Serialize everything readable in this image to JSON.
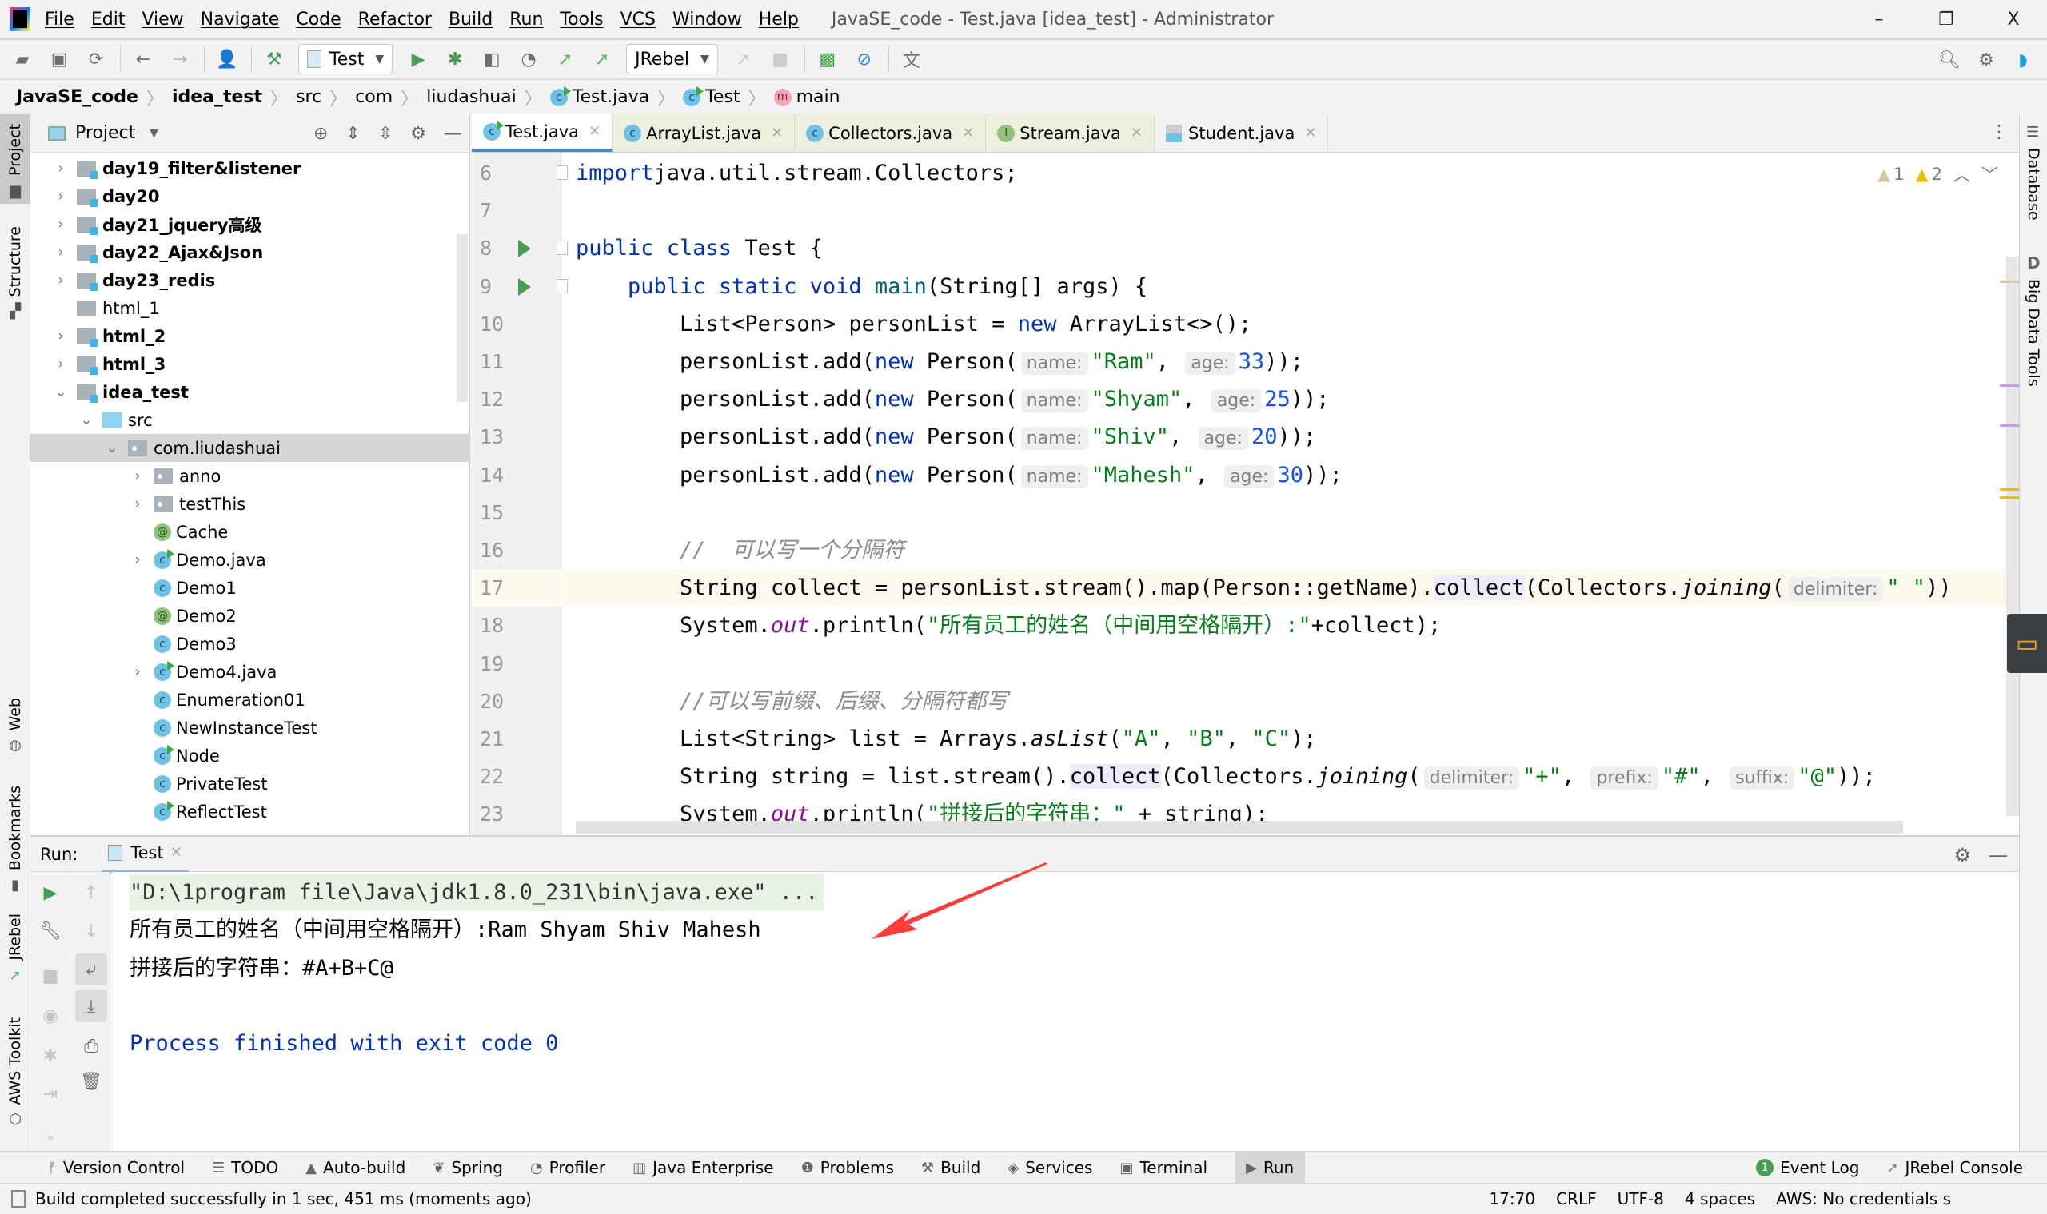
{
  "titlebar": {
    "menu": [
      "File",
      "Edit",
      "View",
      "Navigate",
      "Code",
      "Refactor",
      "Build",
      "Run",
      "Tools",
      "VCS",
      "Window",
      "Help"
    ],
    "window_title": "JavaSE_code - Test.java [idea_test] - Administrator",
    "controls": {
      "minimize": "–",
      "restore": "❐",
      "close": "X"
    }
  },
  "toolbar": {
    "run_config": "Test",
    "jrebel_config": "JRebel",
    "icons": [
      "open-icon",
      "save-icon",
      "sync-icon",
      "back-icon",
      "forward-icon",
      "user-icon",
      "build-hammer-icon",
      "run-icon",
      "debug-icon",
      "coverage-icon",
      "profile-icon",
      "jrebel-run-icon",
      "jrebel-debug-icon",
      "attach-icon",
      "stop-icon",
      "monitor-icon",
      "no-icon",
      "translate-icon",
      "search-icon",
      "settings-icon",
      "toolbox-icon"
    ]
  },
  "breadcrumb": [
    {
      "label": "JavaSE_code",
      "bold": true
    },
    {
      "label": "idea_test",
      "bold": true
    },
    {
      "label": "src"
    },
    {
      "label": "com"
    },
    {
      "label": "liudashuai"
    },
    {
      "label": "Test.java",
      "icon": "class"
    },
    {
      "label": "Test",
      "icon": "class"
    },
    {
      "label": "main",
      "icon": "method"
    }
  ],
  "left_strip": {
    "tabs": [
      "Project",
      "Structure",
      "Web",
      "Bookmarks",
      "JRebel",
      "AWS Toolkit"
    ]
  },
  "right_strip": {
    "tabs": [
      "Database",
      "Big Data Tools"
    ]
  },
  "project_panel": {
    "title": "Project",
    "tree": [
      {
        "label": "day19_filter&listener",
        "type": "module",
        "depth": 0,
        "expand": "collapsed"
      },
      {
        "label": "day20",
        "type": "module",
        "depth": 0,
        "expand": "collapsed"
      },
      {
        "label": "day21_jquery高级",
        "type": "module",
        "depth": 0,
        "expand": "collapsed"
      },
      {
        "label": "day22_Ajax&Json",
        "type": "module",
        "depth": 0,
        "expand": "collapsed"
      },
      {
        "label": "day23_redis",
        "type": "module",
        "depth": 0,
        "expand": "collapsed"
      },
      {
        "label": "html_1",
        "type": "folder",
        "depth": 0,
        "expand": "none"
      },
      {
        "label": "html_2",
        "type": "module",
        "depth": 0,
        "expand": "collapsed"
      },
      {
        "label": "html_3",
        "type": "module",
        "depth": 0,
        "expand": "collapsed"
      },
      {
        "label": "idea_test",
        "type": "module",
        "depth": 0,
        "expand": "expanded"
      },
      {
        "label": "src",
        "type": "src",
        "depth": 1,
        "expand": "expanded"
      },
      {
        "label": "com.liudashuai",
        "type": "package",
        "depth": 2,
        "expand": "expanded",
        "selected": true
      },
      {
        "label": "anno",
        "type": "package",
        "depth": 3,
        "expand": "collapsed"
      },
      {
        "label": "testThis",
        "type": "package",
        "depth": 3,
        "expand": "collapsed"
      },
      {
        "label": "Cache",
        "type": "annotation",
        "depth": 3,
        "expand": "none"
      },
      {
        "label": "Demo.java",
        "type": "class-run",
        "depth": 3,
        "expand": "collapsed"
      },
      {
        "label": "Demo1",
        "type": "class",
        "depth": 3,
        "expand": "none"
      },
      {
        "label": "Demo2",
        "type": "annotation",
        "depth": 3,
        "expand": "none"
      },
      {
        "label": "Demo3",
        "type": "class",
        "depth": 3,
        "expand": "none"
      },
      {
        "label": "Demo4.java",
        "type": "class-run",
        "depth": 3,
        "expand": "collapsed"
      },
      {
        "label": "Enumeration01",
        "type": "class",
        "depth": 3,
        "expand": "none"
      },
      {
        "label": "NewInstanceTest",
        "type": "class",
        "depth": 3,
        "expand": "none"
      },
      {
        "label": "Node",
        "type": "class-run",
        "depth": 3,
        "expand": "none"
      },
      {
        "label": "PrivateTest",
        "type": "class",
        "depth": 3,
        "expand": "none"
      },
      {
        "label": "ReflectTest",
        "type": "class-run",
        "depth": 3,
        "expand": "none"
      }
    ]
  },
  "editor": {
    "tabs": [
      {
        "label": "Test.java",
        "icon": "class-run",
        "active": true
      },
      {
        "label": "ArrayList.java",
        "icon": "class-lib"
      },
      {
        "label": "Collectors.java",
        "icon": "class-lib"
      },
      {
        "label": "Stream.java",
        "icon": "interface-lib"
      },
      {
        "label": "Student.java",
        "icon": "java-file"
      }
    ],
    "inspections": {
      "weak_warnings": "1",
      "warnings": "2"
    },
    "current_line": 17,
    "lines": [
      {
        "n": 6,
        "tokens": [
          [
            "kw",
            "import"
          ],
          [
            "",
            "java.util.stream.Collectors;"
          ]
        ]
      },
      {
        "n": 7,
        "tokens": []
      },
      {
        "n": 8,
        "run": true,
        "tokens": [
          [
            "kw",
            "public class "
          ],
          [
            "",
            "Test {"
          ]
        ]
      },
      {
        "n": 9,
        "run": true,
        "tokens": [
          [
            "",
            "    "
          ],
          [
            "kw",
            "public static void "
          ],
          [
            "mth",
            "main"
          ],
          [
            "",
            "(String[] args) {"
          ]
        ]
      },
      {
        "n": 10,
        "tokens": [
          [
            "",
            "        List<Person> personList = "
          ],
          [
            "kw",
            "new "
          ],
          [
            "",
            "ArrayList<>();"
          ]
        ]
      },
      {
        "n": 11,
        "tokens": [
          [
            "",
            "        personList.add("
          ],
          [
            "kw",
            "new "
          ],
          [
            "",
            "Person("
          ],
          [
            "hint",
            "name:"
          ],
          [
            "str",
            "\"Ram\""
          ],
          [
            "",
            ", "
          ],
          [
            "hint",
            "age:"
          ],
          [
            "num",
            "33"
          ],
          [
            "",
            "));"
          ]
        ]
      },
      {
        "n": 12,
        "tokens": [
          [
            "",
            "        personList.add("
          ],
          [
            "kw",
            "new "
          ],
          [
            "",
            "Person("
          ],
          [
            "hint",
            "name:"
          ],
          [
            "str",
            "\"Shyam\""
          ],
          [
            "",
            ", "
          ],
          [
            "hint",
            "age:"
          ],
          [
            "num",
            "25"
          ],
          [
            "",
            "));"
          ]
        ]
      },
      {
        "n": 13,
        "tokens": [
          [
            "",
            "        personList.add("
          ],
          [
            "kw",
            "new "
          ],
          [
            "",
            "Person("
          ],
          [
            "hint",
            "name:"
          ],
          [
            "str",
            "\"Shiv\""
          ],
          [
            "",
            ", "
          ],
          [
            "hint",
            "age:"
          ],
          [
            "num",
            "20"
          ],
          [
            "",
            "));"
          ]
        ]
      },
      {
        "n": 14,
        "tokens": [
          [
            "",
            "        personList.add("
          ],
          [
            "kw",
            "new "
          ],
          [
            "",
            "Person("
          ],
          [
            "hint",
            "name:"
          ],
          [
            "str",
            "\"Mahesh\""
          ],
          [
            "",
            ", "
          ],
          [
            "hint",
            "age:"
          ],
          [
            "num",
            "30"
          ],
          [
            "",
            "));"
          ]
        ]
      },
      {
        "n": 15,
        "tokens": []
      },
      {
        "n": 16,
        "tokens": [
          [
            "",
            "        "
          ],
          [
            "cmt",
            "//  可以写一个分隔符"
          ]
        ]
      },
      {
        "n": 17,
        "tokens": [
          [
            "",
            "        String collect = personList.stream().map(Person::getName)."
          ],
          [
            "hl",
            "collect"
          ],
          [
            "",
            "(Collectors."
          ],
          [
            "ital",
            "joining"
          ],
          [
            "",
            "("
          ],
          [
            "hint",
            "delimiter:"
          ],
          [
            "str",
            "\" \""
          ],
          [
            "",
            "))"
          ]
        ]
      },
      {
        "n": 18,
        "tokens": [
          [
            "",
            "        System."
          ],
          [
            "fld",
            "out"
          ],
          [
            "",
            ".println("
          ],
          [
            "str",
            "\"所有员工的姓名（中间用空格隔开）:\""
          ],
          [
            "",
            "+collect);"
          ]
        ]
      },
      {
        "n": 19,
        "tokens": []
      },
      {
        "n": 20,
        "tokens": [
          [
            "",
            "        "
          ],
          [
            "cmt",
            "//可以写前缀、后缀、分隔符都写"
          ]
        ]
      },
      {
        "n": 21,
        "tokens": [
          [
            "",
            "        List<String> list = Arrays."
          ],
          [
            "ital",
            "asList"
          ],
          [
            "",
            "("
          ],
          [
            "str",
            "\"A\""
          ],
          [
            "",
            ", "
          ],
          [
            "str",
            "\"B\""
          ],
          [
            "",
            ", "
          ],
          [
            "str",
            "\"C\""
          ],
          [
            "",
            ");"
          ]
        ]
      },
      {
        "n": 22,
        "tokens": [
          [
            "",
            "        String string = list.stream()."
          ],
          [
            "hl",
            "collect"
          ],
          [
            "",
            "(Collectors."
          ],
          [
            "ital",
            "joining"
          ],
          [
            "",
            "("
          ],
          [
            "hint",
            "delimiter:"
          ],
          [
            "str",
            "\"+\""
          ],
          [
            "",
            ", "
          ],
          [
            "hint",
            "prefix:"
          ],
          [
            "str",
            "\"#\""
          ],
          [
            "",
            ", "
          ],
          [
            "hint",
            "suffix:"
          ],
          [
            "str",
            "\"@\""
          ],
          [
            "",
            "));"
          ]
        ]
      },
      {
        "n": 23,
        "tokens": [
          [
            "",
            "        System."
          ],
          [
            "fld",
            "out"
          ],
          [
            "",
            ".println("
          ],
          [
            "str",
            "\"拼接后的字符串：\""
          ],
          [
            "",
            " + string);"
          ]
        ]
      }
    ]
  },
  "run_panel": {
    "label": "Run:",
    "tab": "Test",
    "console": [
      {
        "type": "cmd",
        "text": "\"D:\\1program file\\Java\\jdk1.8.0_231\\bin\\java.exe\" ..."
      },
      {
        "type": "out",
        "text": "所有员工的姓名（中间用空格隔开）:Ram Shyam Shiv Mahesh"
      },
      {
        "type": "out",
        "text": "拼接后的字符串：#A+B+C@"
      },
      {
        "type": "blank",
        "text": ""
      },
      {
        "type": "proc",
        "text": "Process finished with exit code 0"
      }
    ]
  },
  "tool_tabs": {
    "left": [
      {
        "label": "Version Control",
        "icon": "version-control-icon"
      },
      {
        "label": "TODO",
        "icon": "todo-icon"
      },
      {
        "label": "Auto-build",
        "icon": "auto-build-icon"
      },
      {
        "label": "Spring",
        "icon": "spring-icon"
      },
      {
        "label": "Profiler",
        "icon": "profiler-icon"
      },
      {
        "label": "Java Enterprise",
        "icon": "java-enterprise-icon"
      },
      {
        "label": "Problems",
        "icon": "problems-icon"
      },
      {
        "label": "Build",
        "icon": "build-icon"
      },
      {
        "label": "Services",
        "icon": "services-icon"
      },
      {
        "label": "Terminal",
        "icon": "terminal-icon"
      },
      {
        "label": "Run",
        "icon": "run-icon",
        "active": true
      }
    ],
    "right": [
      {
        "label": "Event Log",
        "badge": "1"
      },
      {
        "label": "JRebel Console"
      }
    ]
  },
  "status_bar": {
    "message": "Build completed successfully in 1 sec, 451 ms (moments ago)",
    "position": "17:70",
    "line_separator": "CRLF",
    "encoding": "UTF-8",
    "indent": "4 spaces",
    "aws": "AWS: No credentials s"
  },
  "colors": {
    "keyword": "#0033b3",
    "string": "#067d17",
    "number": "#1750eb",
    "static_field": "#871094",
    "comment": "#8c8c8c",
    "run_green": "#499c54",
    "active_tab_underline": "#4a88c7",
    "annotation_arrow": "#ff3b3b"
  }
}
